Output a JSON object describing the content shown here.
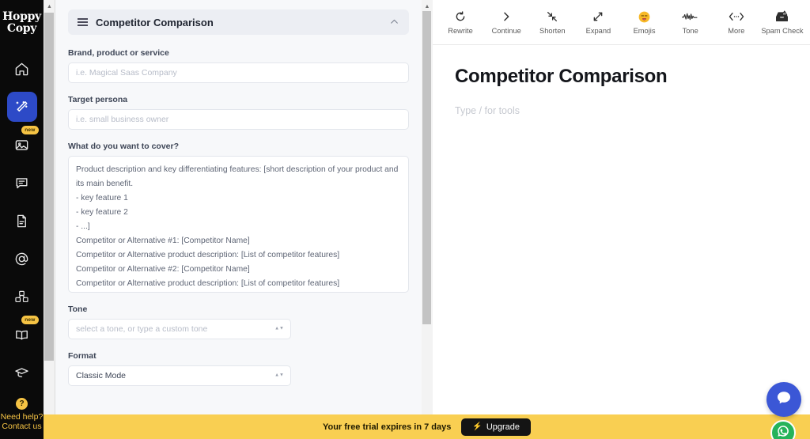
{
  "brand": {
    "line1": "Hoppy",
    "line2": "Copy"
  },
  "colors": {
    "rail_bg": "#0a0a0a",
    "accent_blue": "#2d4ac7",
    "badge_yellow": "#f5c344",
    "banner_yellow": "#f9cf52",
    "upgrade_dark": "#141414",
    "bolt_orange": "#ff7a1a",
    "chat_blue": "#3b57d6",
    "chat_green": "#25b35a",
    "panel_bg": "#f7f8fa"
  },
  "sidebar": {
    "items": [
      {
        "name": "home",
        "icon": "home-icon",
        "active": false,
        "badge": ""
      },
      {
        "name": "generate",
        "icon": "magic-wand-icon",
        "active": true,
        "badge": ""
      },
      {
        "name": "images",
        "icon": "image-icon",
        "active": false,
        "badge": "new"
      },
      {
        "name": "chat",
        "icon": "chat-bubble-icon",
        "active": false,
        "badge": ""
      },
      {
        "name": "documents",
        "icon": "document-icon",
        "active": false,
        "badge": ""
      },
      {
        "name": "email",
        "icon": "at-sign-icon",
        "active": false,
        "badge": ""
      },
      {
        "name": "templates",
        "icon": "blocks-icon",
        "active": false,
        "badge": ""
      },
      {
        "name": "library",
        "icon": "book-icon",
        "active": false,
        "badge": "new"
      },
      {
        "name": "academy",
        "icon": "graduation-cap-icon",
        "active": false,
        "badge": ""
      }
    ],
    "help": {
      "icon": "question-mark-icon",
      "glyph": "?",
      "line1": "Need help?",
      "line2": "Contact us"
    }
  },
  "form": {
    "header": {
      "title": "Competitor Comparison",
      "menu_icon": "hamburger-icon",
      "collapse_icon": "chevron-up-icon"
    },
    "fields": [
      {
        "label": "Brand, product or service",
        "placeholder": "i.e. Magical Saas Company",
        "value": ""
      },
      {
        "label": "Target persona",
        "placeholder": "i.e. small business owner",
        "value": ""
      }
    ],
    "cover": {
      "label": "What do you want to cover?",
      "value": "Product description and key differentiating features: [short description of your product and its main benefit.\n- key feature 1\n- key feature 2\n- ...]\nCompetitor or Alternative #1: [Competitor Name]\nCompetitor or Alternative product description: [List of competitor features]\nCompetitor or Alternative #2: [Competitor Name]\nCompetitor or Alternative product description: [List of competitor features]"
    },
    "tone": {
      "label": "Tone",
      "placeholder": "select a tone, or type a custom tone",
      "value": ""
    },
    "format": {
      "label": "Format",
      "placeholder": "",
      "value": "Classic Mode"
    }
  },
  "toolbar": {
    "items": [
      {
        "label": "Rewrite",
        "icon": "rewrite-refresh-icon"
      },
      {
        "label": "Continue",
        "icon": "chevron-right-icon"
      },
      {
        "label": "Shorten",
        "icon": "shorten-arrows-icon"
      },
      {
        "label": "Expand",
        "icon": "expand-arrows-icon"
      },
      {
        "label": "Emojis",
        "icon": "emoji-face-icon"
      },
      {
        "label": "Tone",
        "icon": "waveform-icon"
      },
      {
        "label": "More",
        "icon": "more-code-icon"
      },
      {
        "label": "Spam Check",
        "icon": "spam-inbox-icon"
      }
    ]
  },
  "editor": {
    "title": "Competitor Comparison",
    "placeholder": "Type / for tools"
  },
  "banner": {
    "text": "Your free trial expires in 7 days",
    "button_label": "Upgrade",
    "button_icon": "bolt-icon",
    "bolt": "⚡"
  },
  "chat": {
    "primary_icon": "chat-bubble-icon",
    "secondary_icon": "whatsapp-icon"
  }
}
